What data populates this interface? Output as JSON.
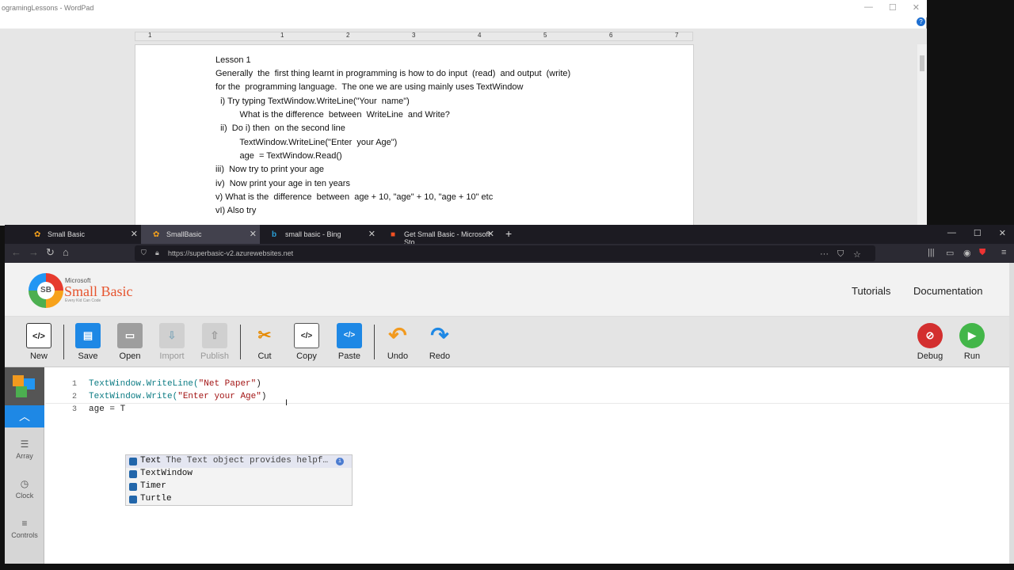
{
  "wordpad": {
    "title": "ogramingLessons - WordPad",
    "controls": [
      "—",
      "☐",
      "✕"
    ],
    "help": "?",
    "ruler_ticks": [
      "1",
      "1",
      "2",
      "3",
      "4",
      "5",
      "6",
      "7"
    ],
    "lines": [
      "Lesson 1",
      "Generally  the  first thing learnt in programming is how to do input  (read)  and output  (write)",
      "for the  programming language.  The one we are using mainly uses TextWindow",
      "  i) Try typing TextWindow.WriteLine(\"Your  name\")",
      "          What is the difference  between  WriteLine  and Write?",
      "  ii)  Do i) then  on the second line",
      "          TextWindow.WriteLine(\"Enter  your Age\")",
      "          age  = TextWindow.Read()",
      "iii)  Now try to print your age",
      "iv)  Now print your age in ten years",
      "v) What is the  difference  between  age + 10, \"age\" + 10, \"age + 10\" etc",
      "vI) Also try"
    ]
  },
  "browser": {
    "tabs": [
      {
        "title": "Small Basic",
        "icon": "smallbasic-icon",
        "active": false
      },
      {
        "title": "SmallBasic",
        "icon": "smallbasic-icon",
        "active": true
      },
      {
        "title": "small basic - Bing",
        "icon": "bing-icon",
        "active": false
      },
      {
        "title": "Get Small Basic - Microsoft Sto",
        "icon": "microsoft-icon",
        "active": false
      }
    ],
    "url": "https://superbasic-v2.azurewebsites.net",
    "window_controls": [
      "—",
      "☐",
      "✕"
    ]
  },
  "site": {
    "brand_small": "Microsoft",
    "brand": "Small Basic",
    "tagline": "Every Kid Can Code",
    "logo_text": "SB",
    "nav": [
      "Tutorials",
      "Documentation"
    ]
  },
  "toolbar": {
    "new": "New",
    "save": "Save",
    "open": "Open",
    "import": "Import",
    "publish": "Publish",
    "cut": "Cut",
    "copy": "Copy",
    "paste": "Paste",
    "undo": "Undo",
    "redo": "Redo",
    "debug": "Debug",
    "run": "Run"
  },
  "sidebar": {
    "items": [
      {
        "label": "Array",
        "icon": "list-icon"
      },
      {
        "label": "Clock",
        "icon": "clock-icon"
      },
      {
        "label": "Controls",
        "icon": "sliders-icon"
      }
    ]
  },
  "editor": {
    "line_numbers": [
      "1",
      "2",
      "3"
    ],
    "line1_obj": "TextWindow",
    "line1_method": ".WriteLine(",
    "line1_str": "\"Net Paper\"",
    "line1_end": ")",
    "line2_obj": "TextWindow",
    "line2_method": ".Write(",
    "line2_str": "\"Enter your Age\"",
    "line2_end": ")",
    "line3": "age = T"
  },
  "autocomplete": {
    "items": [
      {
        "name": "Text",
        "desc": "The Text object provides helpf…"
      },
      {
        "name": "TextWindow",
        "desc": ""
      },
      {
        "name": "Timer",
        "desc": ""
      },
      {
        "name": "Turtle",
        "desc": ""
      }
    ]
  },
  "colors": {
    "accent": "#1e88e5",
    "brand": "#e6542e"
  }
}
